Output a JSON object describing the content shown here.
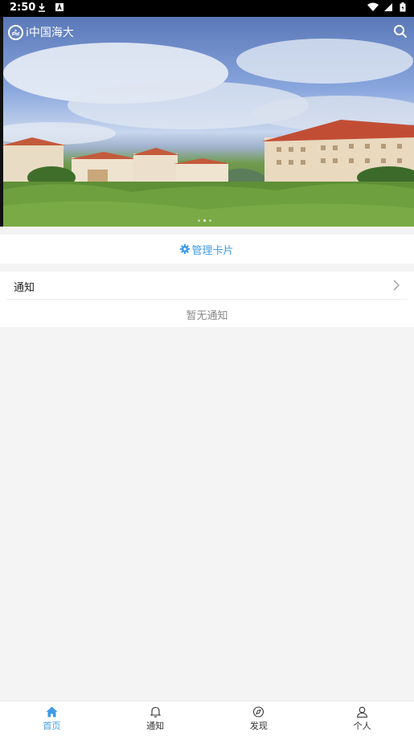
{
  "status_bar": {
    "time": "2:50",
    "icons_left": [
      "download-icon",
      "a-box-icon"
    ],
    "icons_right": [
      "wifi-icon",
      "signal-icon",
      "battery-icon"
    ]
  },
  "header": {
    "app_name": "i中国海大",
    "logo_icon": "ocean-university-logo-icon",
    "search_icon": "search-icon"
  },
  "banner": {
    "image": "campus-buildings-photo",
    "page_count": 3,
    "active_page": 2
  },
  "manage_cards": {
    "label": "管理卡片",
    "icon": "gear-icon"
  },
  "notifications": {
    "title": "通知",
    "empty_text": "暂无通知"
  },
  "bottom_nav": {
    "items": [
      {
        "label": "首页",
        "icon": "home-icon",
        "active": true
      },
      {
        "label": "通知",
        "icon": "bell-icon",
        "active": false
      },
      {
        "label": "发现",
        "icon": "compass-icon",
        "active": false
      },
      {
        "label": "个人",
        "icon": "person-icon",
        "active": false
      }
    ]
  },
  "colors": {
    "accent": "#3d9be9",
    "background": "#f4f4f4"
  }
}
